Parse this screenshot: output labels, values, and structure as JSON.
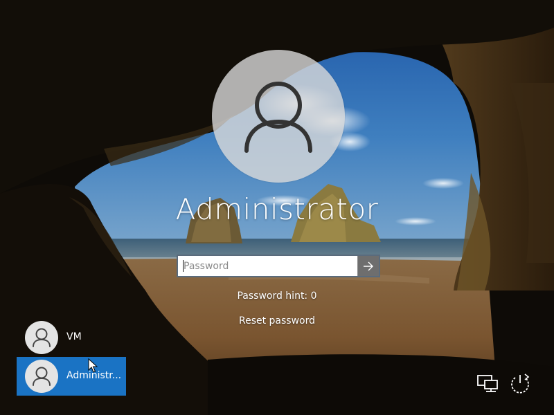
{
  "login": {
    "username": "Administrator",
    "password_placeholder": "Password",
    "password_value": "",
    "password_hint": "Password hint: 0",
    "reset_password": "Reset password"
  },
  "users": [
    {
      "name": "VM",
      "selected": false
    },
    {
      "name": "Administr...",
      "selected": true
    }
  ],
  "icons": {
    "submit": "arrow-right-icon",
    "network": "network-icon",
    "power": "power-icon",
    "avatar": "user-icon"
  },
  "colors": {
    "selected_user_bg": "#1a73c4",
    "submit_button_bg": "#6e6e6e"
  }
}
